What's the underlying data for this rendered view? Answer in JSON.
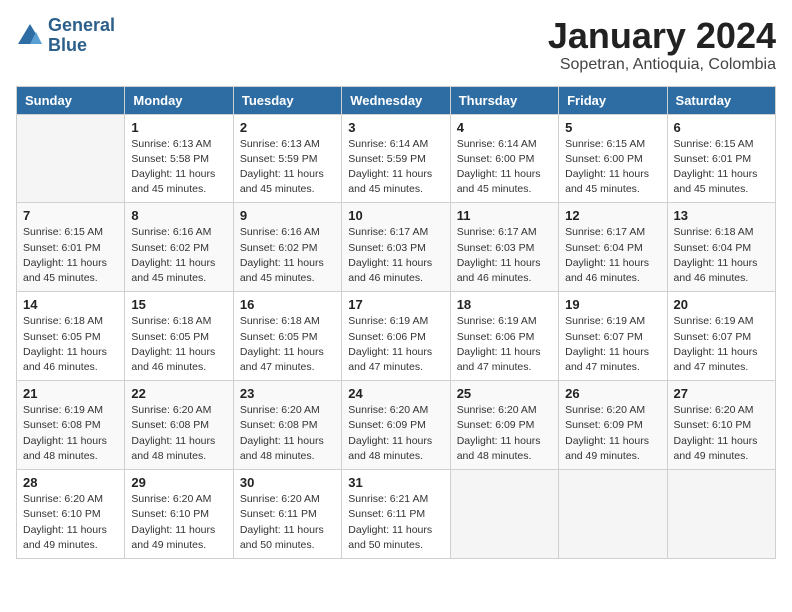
{
  "header": {
    "logo_line1": "General",
    "logo_line2": "Blue",
    "title": "January 2024",
    "subtitle": "Sopetran, Antioquia, Colombia"
  },
  "weekdays": [
    "Sunday",
    "Monday",
    "Tuesday",
    "Wednesday",
    "Thursday",
    "Friday",
    "Saturday"
  ],
  "weeks": [
    [
      {
        "day": "",
        "info": ""
      },
      {
        "day": "1",
        "info": "Sunrise: 6:13 AM\nSunset: 5:58 PM\nDaylight: 11 hours\nand 45 minutes."
      },
      {
        "day": "2",
        "info": "Sunrise: 6:13 AM\nSunset: 5:59 PM\nDaylight: 11 hours\nand 45 minutes."
      },
      {
        "day": "3",
        "info": "Sunrise: 6:14 AM\nSunset: 5:59 PM\nDaylight: 11 hours\nand 45 minutes."
      },
      {
        "day": "4",
        "info": "Sunrise: 6:14 AM\nSunset: 6:00 PM\nDaylight: 11 hours\nand 45 minutes."
      },
      {
        "day": "5",
        "info": "Sunrise: 6:15 AM\nSunset: 6:00 PM\nDaylight: 11 hours\nand 45 minutes."
      },
      {
        "day": "6",
        "info": "Sunrise: 6:15 AM\nSunset: 6:01 PM\nDaylight: 11 hours\nand 45 minutes."
      }
    ],
    [
      {
        "day": "7",
        "info": "Sunrise: 6:15 AM\nSunset: 6:01 PM\nDaylight: 11 hours\nand 45 minutes."
      },
      {
        "day": "8",
        "info": "Sunrise: 6:16 AM\nSunset: 6:02 PM\nDaylight: 11 hours\nand 45 minutes."
      },
      {
        "day": "9",
        "info": "Sunrise: 6:16 AM\nSunset: 6:02 PM\nDaylight: 11 hours\nand 45 minutes."
      },
      {
        "day": "10",
        "info": "Sunrise: 6:17 AM\nSunset: 6:03 PM\nDaylight: 11 hours\nand 46 minutes."
      },
      {
        "day": "11",
        "info": "Sunrise: 6:17 AM\nSunset: 6:03 PM\nDaylight: 11 hours\nand 46 minutes."
      },
      {
        "day": "12",
        "info": "Sunrise: 6:17 AM\nSunset: 6:04 PM\nDaylight: 11 hours\nand 46 minutes."
      },
      {
        "day": "13",
        "info": "Sunrise: 6:18 AM\nSunset: 6:04 PM\nDaylight: 11 hours\nand 46 minutes."
      }
    ],
    [
      {
        "day": "14",
        "info": "Sunrise: 6:18 AM\nSunset: 6:05 PM\nDaylight: 11 hours\nand 46 minutes."
      },
      {
        "day": "15",
        "info": "Sunrise: 6:18 AM\nSunset: 6:05 PM\nDaylight: 11 hours\nand 46 minutes."
      },
      {
        "day": "16",
        "info": "Sunrise: 6:18 AM\nSunset: 6:05 PM\nDaylight: 11 hours\nand 47 minutes."
      },
      {
        "day": "17",
        "info": "Sunrise: 6:19 AM\nSunset: 6:06 PM\nDaylight: 11 hours\nand 47 minutes."
      },
      {
        "day": "18",
        "info": "Sunrise: 6:19 AM\nSunset: 6:06 PM\nDaylight: 11 hours\nand 47 minutes."
      },
      {
        "day": "19",
        "info": "Sunrise: 6:19 AM\nSunset: 6:07 PM\nDaylight: 11 hours\nand 47 minutes."
      },
      {
        "day": "20",
        "info": "Sunrise: 6:19 AM\nSunset: 6:07 PM\nDaylight: 11 hours\nand 47 minutes."
      }
    ],
    [
      {
        "day": "21",
        "info": "Sunrise: 6:19 AM\nSunset: 6:08 PM\nDaylight: 11 hours\nand 48 minutes."
      },
      {
        "day": "22",
        "info": "Sunrise: 6:20 AM\nSunset: 6:08 PM\nDaylight: 11 hours\nand 48 minutes."
      },
      {
        "day": "23",
        "info": "Sunrise: 6:20 AM\nSunset: 6:08 PM\nDaylight: 11 hours\nand 48 minutes."
      },
      {
        "day": "24",
        "info": "Sunrise: 6:20 AM\nSunset: 6:09 PM\nDaylight: 11 hours\nand 48 minutes."
      },
      {
        "day": "25",
        "info": "Sunrise: 6:20 AM\nSunset: 6:09 PM\nDaylight: 11 hours\nand 48 minutes."
      },
      {
        "day": "26",
        "info": "Sunrise: 6:20 AM\nSunset: 6:09 PM\nDaylight: 11 hours\nand 49 minutes."
      },
      {
        "day": "27",
        "info": "Sunrise: 6:20 AM\nSunset: 6:10 PM\nDaylight: 11 hours\nand 49 minutes."
      }
    ],
    [
      {
        "day": "28",
        "info": "Sunrise: 6:20 AM\nSunset: 6:10 PM\nDaylight: 11 hours\nand 49 minutes."
      },
      {
        "day": "29",
        "info": "Sunrise: 6:20 AM\nSunset: 6:10 PM\nDaylight: 11 hours\nand 49 minutes."
      },
      {
        "day": "30",
        "info": "Sunrise: 6:20 AM\nSunset: 6:11 PM\nDaylight: 11 hours\nand 50 minutes."
      },
      {
        "day": "31",
        "info": "Sunrise: 6:21 AM\nSunset: 6:11 PM\nDaylight: 11 hours\nand 50 minutes."
      },
      {
        "day": "",
        "info": ""
      },
      {
        "day": "",
        "info": ""
      },
      {
        "day": "",
        "info": ""
      }
    ]
  ]
}
